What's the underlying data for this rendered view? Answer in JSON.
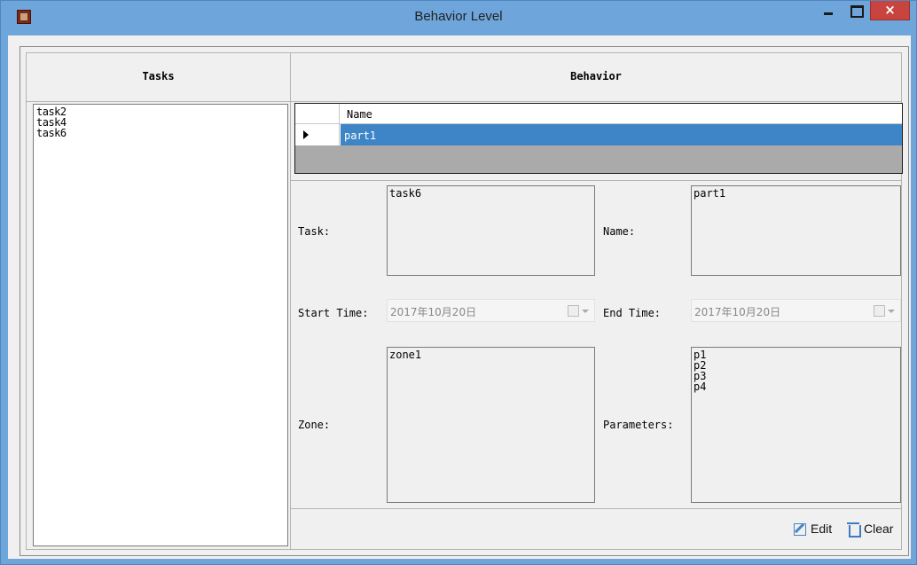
{
  "window": {
    "title": "Behavior Level",
    "close_glyph": "×"
  },
  "tasks_panel": {
    "header": "Tasks",
    "items": [
      "task2",
      "task4",
      "task6"
    ]
  },
  "behavior_panel": {
    "header": "Behavior",
    "grid": {
      "columns": [
        "Name"
      ],
      "rows": [
        {
          "name": "part1",
          "selected": true
        }
      ]
    },
    "form": {
      "task_label": "Task:",
      "task_value": "task6",
      "name_label": "Name:",
      "name_value": "part1",
      "start_label": "Start Time:",
      "start_value": "2017年10月20日",
      "end_label": "End Time:",
      "end_value": "2017年10月20日",
      "zone_label": "Zone:",
      "zone_value": "zone1",
      "params_label": "Parameters:",
      "params_values": [
        "p1",
        "p2",
        "p3",
        "p4"
      ]
    },
    "actions": {
      "edit_label": "Edit",
      "clear_label": "Clear"
    }
  },
  "colors": {
    "titlebar": "#6ea6dc",
    "selection": "#3d85c6",
    "close_button": "#c7453e"
  }
}
